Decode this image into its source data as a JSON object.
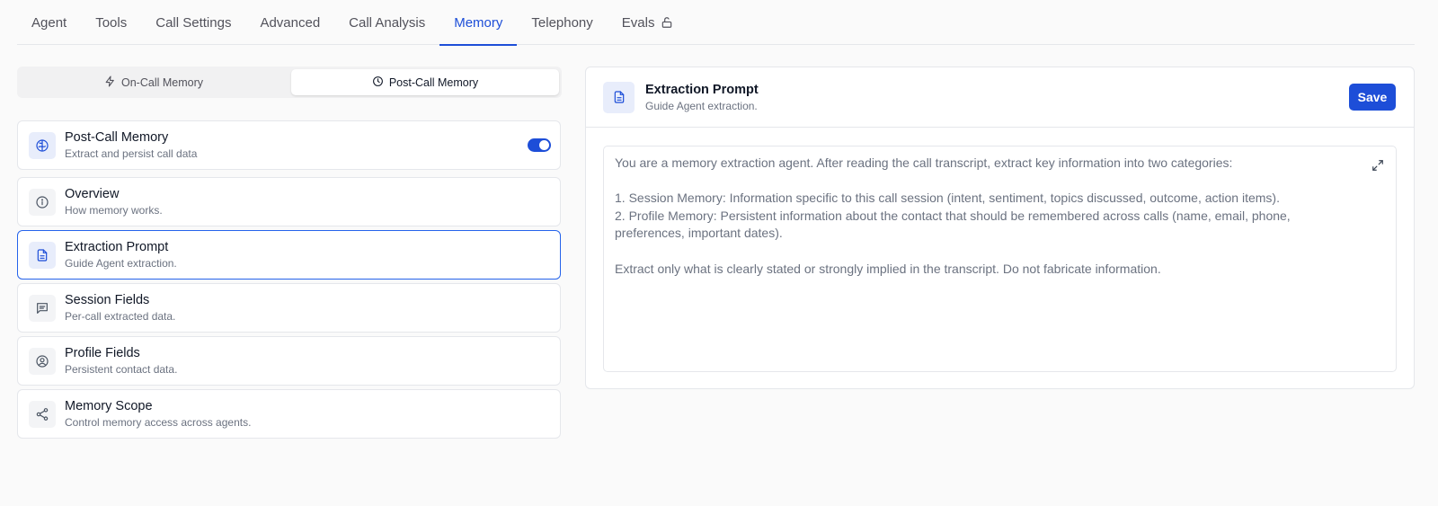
{
  "tabs": [
    {
      "label": "Agent"
    },
    {
      "label": "Tools"
    },
    {
      "label": "Call Settings"
    },
    {
      "label": "Advanced"
    },
    {
      "label": "Call Analysis"
    },
    {
      "label": "Memory"
    },
    {
      "label": "Telephony"
    },
    {
      "label": "Evals"
    }
  ],
  "active_tab": "Memory",
  "segment": {
    "on_call": "On-Call Memory",
    "post_call": "Post-Call Memory",
    "active": "Post-Call Memory"
  },
  "post_call_card": {
    "title": "Post-Call Memory",
    "subtitle": "Extract and persist call data",
    "enabled": true
  },
  "menu": [
    {
      "title": "Overview",
      "subtitle": "How memory works.",
      "icon": "info-icon"
    },
    {
      "title": "Extraction Prompt",
      "subtitle": "Guide Agent extraction.",
      "icon": "document-icon"
    },
    {
      "title": "Session Fields",
      "subtitle": "Per-call extracted data.",
      "icon": "message-icon"
    },
    {
      "title": "Profile Fields",
      "subtitle": "Persistent contact data.",
      "icon": "user-circle-icon"
    },
    {
      "title": "Memory Scope",
      "subtitle": "Control memory access across agents.",
      "icon": "share-icon"
    }
  ],
  "selected_menu": "Extraction Prompt",
  "panel": {
    "title": "Extraction Prompt",
    "subtitle": "Guide Agent extraction.",
    "save_label": "Save",
    "prompt_lines": [
      "You are a memory extraction agent. After reading the call transcript, extract key information into two categories:",
      "",
      "1. Session Memory: Information specific to this call session (intent, sentiment, topics discussed, outcome, action items).",
      "2. Profile Memory: Persistent information about the contact that should be remembered across calls (name, email, phone, preferences, important dates).",
      "",
      "Extract only what is clearly stated or strongly implied in the transcript. Do not fabricate information."
    ]
  },
  "colors": {
    "accent": "#1d4ed8",
    "background": "#fafafa",
    "border": "#e5e7eb"
  }
}
